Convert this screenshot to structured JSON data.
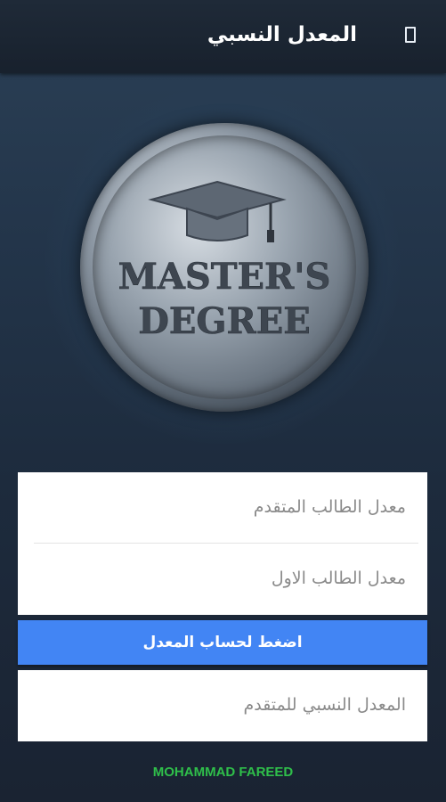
{
  "appbar": {
    "title": "المعدل النسبي",
    "menu_icon": "menu-square-icon"
  },
  "hero": {
    "logo_line1": "MASTER'S",
    "logo_line2": "DEGREE",
    "logo_icon": "graduation-cap-icon"
  },
  "form": {
    "advanced_rate_placeholder": "معدل الطالب المتقدم",
    "first_rate_placeholder": "معدل الطالب الاول",
    "calculate_label": "اضغط لحساب المعدل",
    "result_placeholder": "المعدل النسبي للمتقدم"
  },
  "footer": {
    "author": "MOHAMMAD FAREED"
  },
  "colors": {
    "accent": "#4285f4",
    "author_text": "#2fbf4a",
    "background": "#23354a"
  }
}
